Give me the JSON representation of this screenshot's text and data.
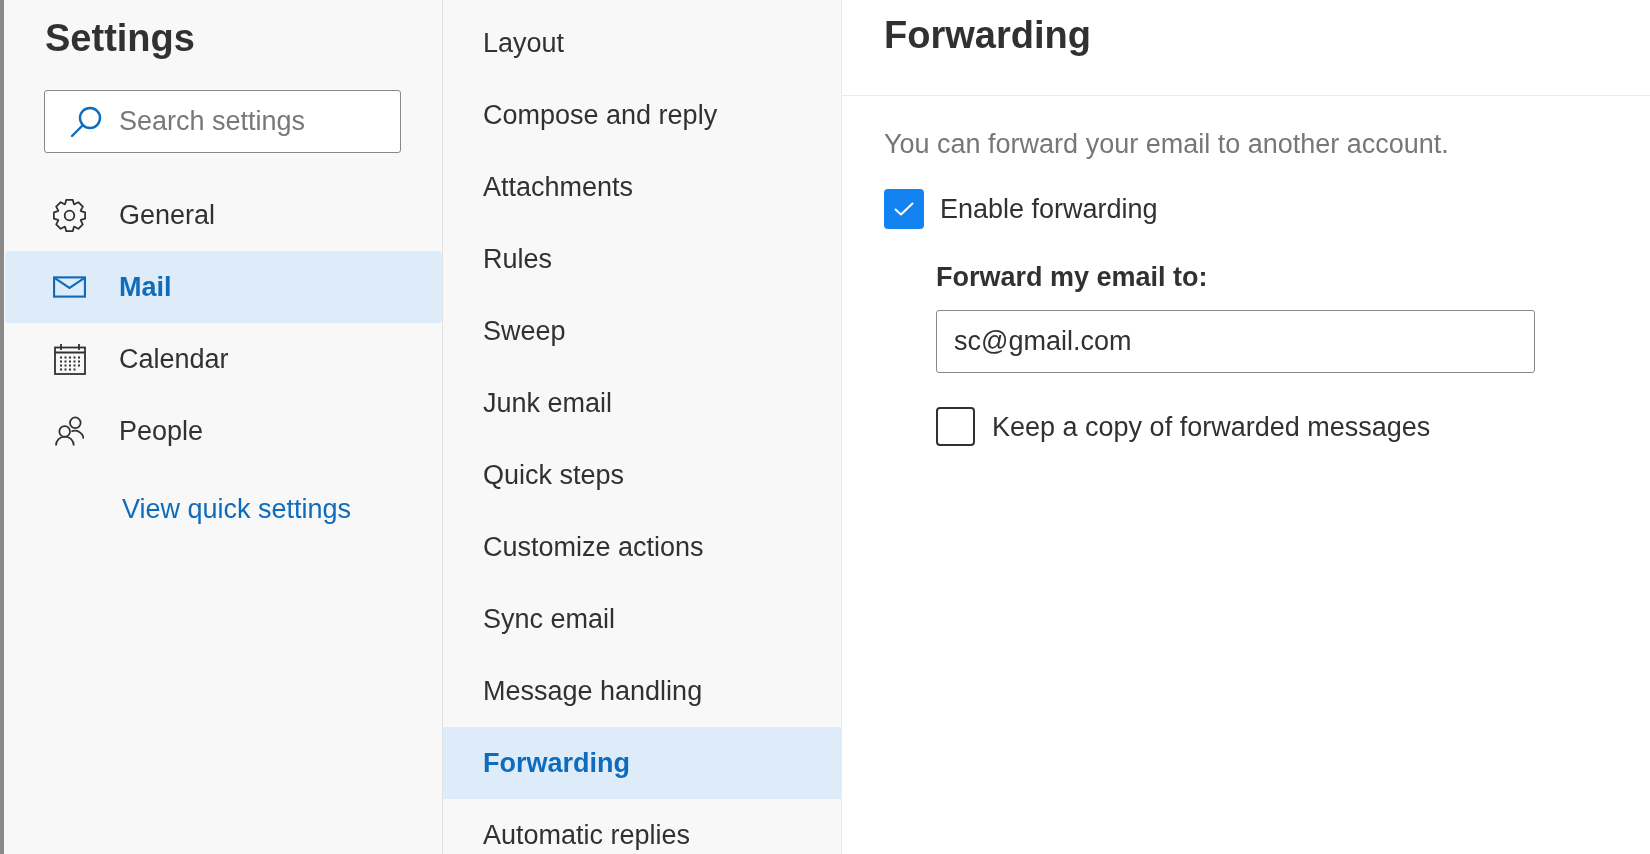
{
  "sidebar": {
    "title": "Settings",
    "search": {
      "placeholder": "Search settings"
    },
    "items": [
      {
        "label": "General",
        "selected": false
      },
      {
        "label": "Mail",
        "selected": true
      },
      {
        "label": "Calendar",
        "selected": false
      },
      {
        "label": "People",
        "selected": false
      }
    ],
    "link": "View quick settings"
  },
  "category_menu": {
    "items": [
      {
        "label": "Layout",
        "selected": false
      },
      {
        "label": "Compose and reply",
        "selected": false
      },
      {
        "label": "Attachments",
        "selected": false
      },
      {
        "label": "Rules",
        "selected": false
      },
      {
        "label": "Sweep",
        "selected": false
      },
      {
        "label": "Junk email",
        "selected": false
      },
      {
        "label": "Quick steps",
        "selected": false
      },
      {
        "label": "Customize actions",
        "selected": false
      },
      {
        "label": "Sync email",
        "selected": false
      },
      {
        "label": "Message handling",
        "selected": false
      },
      {
        "label": "Forwarding",
        "selected": true
      },
      {
        "label": "Automatic replies",
        "selected": false
      }
    ]
  },
  "content": {
    "title": "Forwarding",
    "description": "You can forward your email to another account.",
    "enable_forwarding": {
      "label": "Enable forwarding",
      "checked": true
    },
    "forward_to": {
      "label": "Forward my email to:",
      "value": "sc@gmail.com"
    },
    "keep_copy": {
      "label": "Keep a copy of forwarded messages",
      "checked": false
    }
  }
}
